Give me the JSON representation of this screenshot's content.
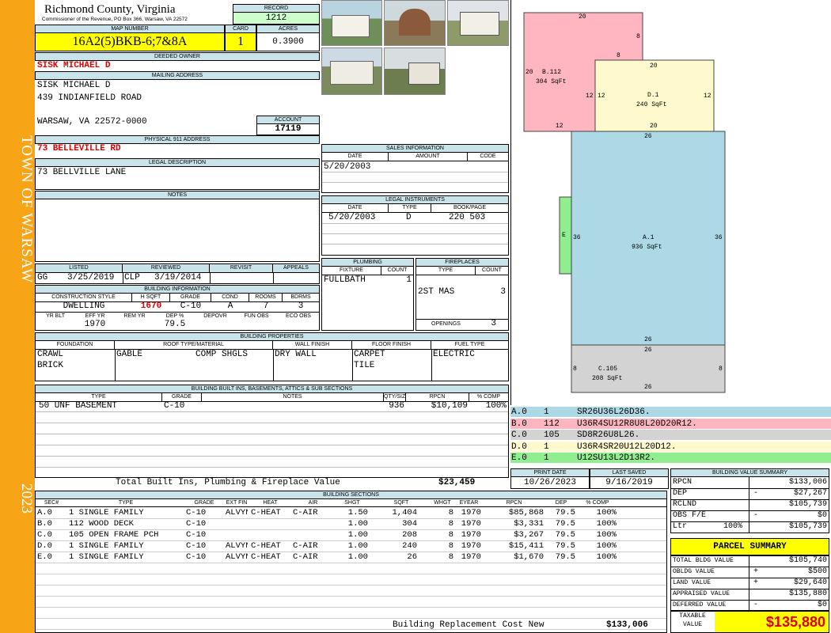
{
  "county": {
    "title": "Richmond County, Virginia",
    "subtitle": "Commissioner of the Revenue, PO Box 366, Warsaw, VA 22572"
  },
  "side": {
    "town": "TOWN OF WARSAW",
    "year": "2023"
  },
  "record": {
    "label": "RECORD",
    "value": "1212"
  },
  "map": {
    "label": "MAP NUMBER",
    "value": "16A2(5)BKB-6;7&8A",
    "card_label": "CARD",
    "card": "1",
    "acres_label": "ACRES",
    "acres": "0.3900"
  },
  "owner": {
    "label": "DEEDED OWNER",
    "value": "SISK MICHAEL D"
  },
  "mailing": {
    "label": "MAILING ADDRESS",
    "line1": "SISK MICHAEL D",
    "line2": "439 INDIANFIELD ROAD",
    "line3": "WARSAW, VA 22572-0000"
  },
  "account": {
    "label": "ACCOUNT",
    "value": "17119"
  },
  "physical": {
    "label": "PHYSICAL 911 ADDRESS",
    "value": "73 BELLEVILLE RD"
  },
  "legal": {
    "label": "LEGAL DESCRIPTION",
    "value": "73 BELLVILLE LANE"
  },
  "notes": {
    "label": "NOTES"
  },
  "sales": {
    "label": "SALES INFORMATION",
    "cols": [
      "DATE",
      "AMOUNT",
      "CODE"
    ],
    "date": "5/20/2003"
  },
  "instruments": {
    "label": "LEGAL INSTRUMENTS",
    "cols": [
      "DATE",
      "TYPE",
      "BOOK/PAGE"
    ],
    "date": "5/20/2003",
    "type": "D",
    "book": "220 503"
  },
  "status": {
    "listed_label": "LISTED",
    "reviewed_label": "REVIEWED",
    "revisit_label": "REVISIT",
    "appeals_label": "APPEALS",
    "listed_by": "GG",
    "listed": "3/25/2019",
    "reviewed_by": "CLP",
    "reviewed": "3/19/2014"
  },
  "building": {
    "label": "BUILDING INFORMATION",
    "cols": [
      "CONSTRUCTION STYLE",
      "H SQFT",
      "GRADE",
      "COND",
      "ROOMS",
      "BDRMS"
    ],
    "style": "DWELLING",
    "hsqft": "1670",
    "grade": "C-10",
    "cond": "A",
    "rooms": "7",
    "bdrms": "3",
    "cols2": [
      "YR BLT",
      "EFF YR",
      "REM YR",
      "DEP %",
      "DEPOVR",
      "FUN OBS",
      "ECO OBS"
    ],
    "eff_yr": "1970",
    "dep": "79.5"
  },
  "plumbing": {
    "label": "PLUMBING",
    "cols": [
      "FIXTURE",
      "COUNT"
    ],
    "fixture": "FULLBATH",
    "count": "1"
  },
  "fireplaces": {
    "label": "FIREPLACES",
    "cols": [
      "TYPE",
      "COUNT"
    ],
    "type": "2ST MAS",
    "count": "3",
    "openings_label": "OPENINGS",
    "openings": "3"
  },
  "properties": {
    "label": "BUILDING PROPERTIES",
    "cols": [
      "FOUNDATION",
      "ROOF TYPE/MATERIAL",
      "WALL FINISH",
      "FLOOR FINISH",
      "FUEL TYPE"
    ],
    "foundation1": "CRAWL",
    "foundation2": "BRICK",
    "roof_type": "GABLE",
    "roof_mat": "COMP SHGLS",
    "wall": "DRY WALL",
    "floor1": "CARPET",
    "floor2": "TILE",
    "fuel": "ELECTRIC"
  },
  "builtins": {
    "label": "BUILDING BUILT INS, BASEMENTS, ATTICS & SUB SECTIONS",
    "cols": [
      "TYPE",
      "GRADE",
      "NOTES",
      "QTY/SIZE",
      "RPCN",
      "% COMP"
    ],
    "row": {
      "type": "50 UNF BASEMENT",
      "grade": "C-10",
      "qty": "936",
      "rpcn": "$10,109",
      "comp": "100%"
    },
    "total_label": "Total Built Ins, Plumbing & Fireplace Value",
    "total": "$23,459"
  },
  "print": {
    "print_label": "PRINT DATE",
    "print_date": "10/26/2023",
    "saved_label": "LAST SAVED",
    "saved": "9/16/2019"
  },
  "sections": {
    "label": "BUILDING SECTIONS",
    "cols": [
      "SEC#",
      "TYPE",
      "GRADE",
      "EXT FIN",
      "HEAT",
      "AIR",
      "SHGT",
      "SQFT",
      "WHGT",
      "EYEAR",
      "RPCN",
      "DEP",
      "% COMP"
    ],
    "rows": [
      [
        "A.0",
        "1 SINGLE FAMILY",
        "C-10",
        "ALVYN",
        "C-HEAT",
        "C-AIR",
        "1.50",
        "1,404",
        "8",
        "1970",
        "$85,868",
        "79.5",
        "100%"
      ],
      [
        "B.0",
        "112 WOOD DECK",
        "C-10",
        "",
        "",
        "",
        "1.00",
        "304",
        "8",
        "1970",
        "$3,331",
        "79.5",
        "100%"
      ],
      [
        "C.0",
        "105 OPEN FRAME PCH",
        "C-10",
        "",
        "",
        "",
        "1.00",
        "208",
        "8",
        "1970",
        "$3,267",
        "79.5",
        "100%"
      ],
      [
        "D.0",
        "1 SINGLE FAMILY",
        "C-10",
        "ALVYN",
        "C-HEAT",
        "C-AIR",
        "1.00",
        "240",
        "8",
        "1970",
        "$15,411",
        "79.5",
        "100%"
      ],
      [
        "E.0",
        "1 SINGLE FAMILY",
        "C-10",
        "ALVYN",
        "C-HEAT",
        "C-AIR",
        "1.00",
        "26",
        "8",
        "1970",
        "$1,670",
        "79.5",
        "100%"
      ]
    ],
    "total_label": "Building Replacement Cost New",
    "total": "$133,006"
  },
  "sketch": {
    "b_label": "B.112",
    "b_area": "304 SqFt",
    "d_label": "D.1",
    "d_area": "240 SqFt",
    "a_label": "A.1",
    "a_area": "936 SqFt",
    "c_label": "C.105",
    "c_area": "208 SqFt",
    "e_label": "E",
    "dims": {
      "b_top": "20",
      "b_right": "8",
      "b_left": "20",
      "b_bottom": "12",
      "d_top": "20",
      "d_left": "12",
      "d_left2": "12",
      "d_right": "12",
      "d_bottom": "20",
      "d_mid": "8",
      "a_top": "26",
      "a_left": "36",
      "a_right": "36",
      "a_bottom": "26",
      "c_top": "26",
      "c_left": "8",
      "c_right": "8",
      "c_bottom": "26"
    }
  },
  "legend": [
    {
      "sec": "A.0",
      "code": "1",
      "desc": "SR26U36L26D36.",
      "color": "#add8e6"
    },
    {
      "sec": "B.0",
      "code": "112",
      "desc": "U36R4SU12R8U8L20D20R12.",
      "color": "#ffb6c1"
    },
    {
      "sec": "C.0",
      "code": "105",
      "desc": "SD8R26U8L26.",
      "color": "#d3d3d3"
    },
    {
      "sec": "D.0",
      "code": "1",
      "desc": "U36R4SR20U12L20D12.",
      "color": "#fffacd"
    },
    {
      "sec": "E.0",
      "code": "1",
      "desc": "U12SU13L2D13R2.",
      "color": "#90ee90"
    }
  ],
  "value_summary": {
    "label": "BUILDING VALUE SUMMARY",
    "rpcn_label": "RPCN",
    "rpcn": "$133,006",
    "dep_label": "DEP",
    "dep": "$27,267",
    "rclnd_label": "RCLND",
    "rclnd": "$105,739",
    "obs_label": "OBS F/E",
    "obs": "$0",
    "ltr_label": "Ltr",
    "ltr_pct": "100%",
    "ltr": "$105,739",
    "minus": "-"
  },
  "parcel": {
    "label": "PARCEL SUMMARY",
    "rows": [
      {
        "label": "TOTAL BLDG VALUE",
        "sign": "",
        "value": "$105,740"
      },
      {
        "label": "OBLDG VALUE",
        "sign": "+",
        "value": "$500"
      },
      {
        "label": "LAND VALUE",
        "sign": "+",
        "value": "$29,640"
      },
      {
        "label": "APPRAISED VALUE",
        "sign": "",
        "value": "$135,880"
      },
      {
        "label": "DEFERRED VALUE",
        "sign": "-",
        "value": "$0"
      }
    ],
    "taxable_label1": "TAXABLE",
    "taxable_label2": "VALUE",
    "taxable": "$135,880"
  },
  "colors": {
    "orange": "#f7a417",
    "header": "#c8e3ea",
    "yellow": "#ffff00",
    "green": "#ccffcc",
    "accent_red": "#e00000"
  }
}
